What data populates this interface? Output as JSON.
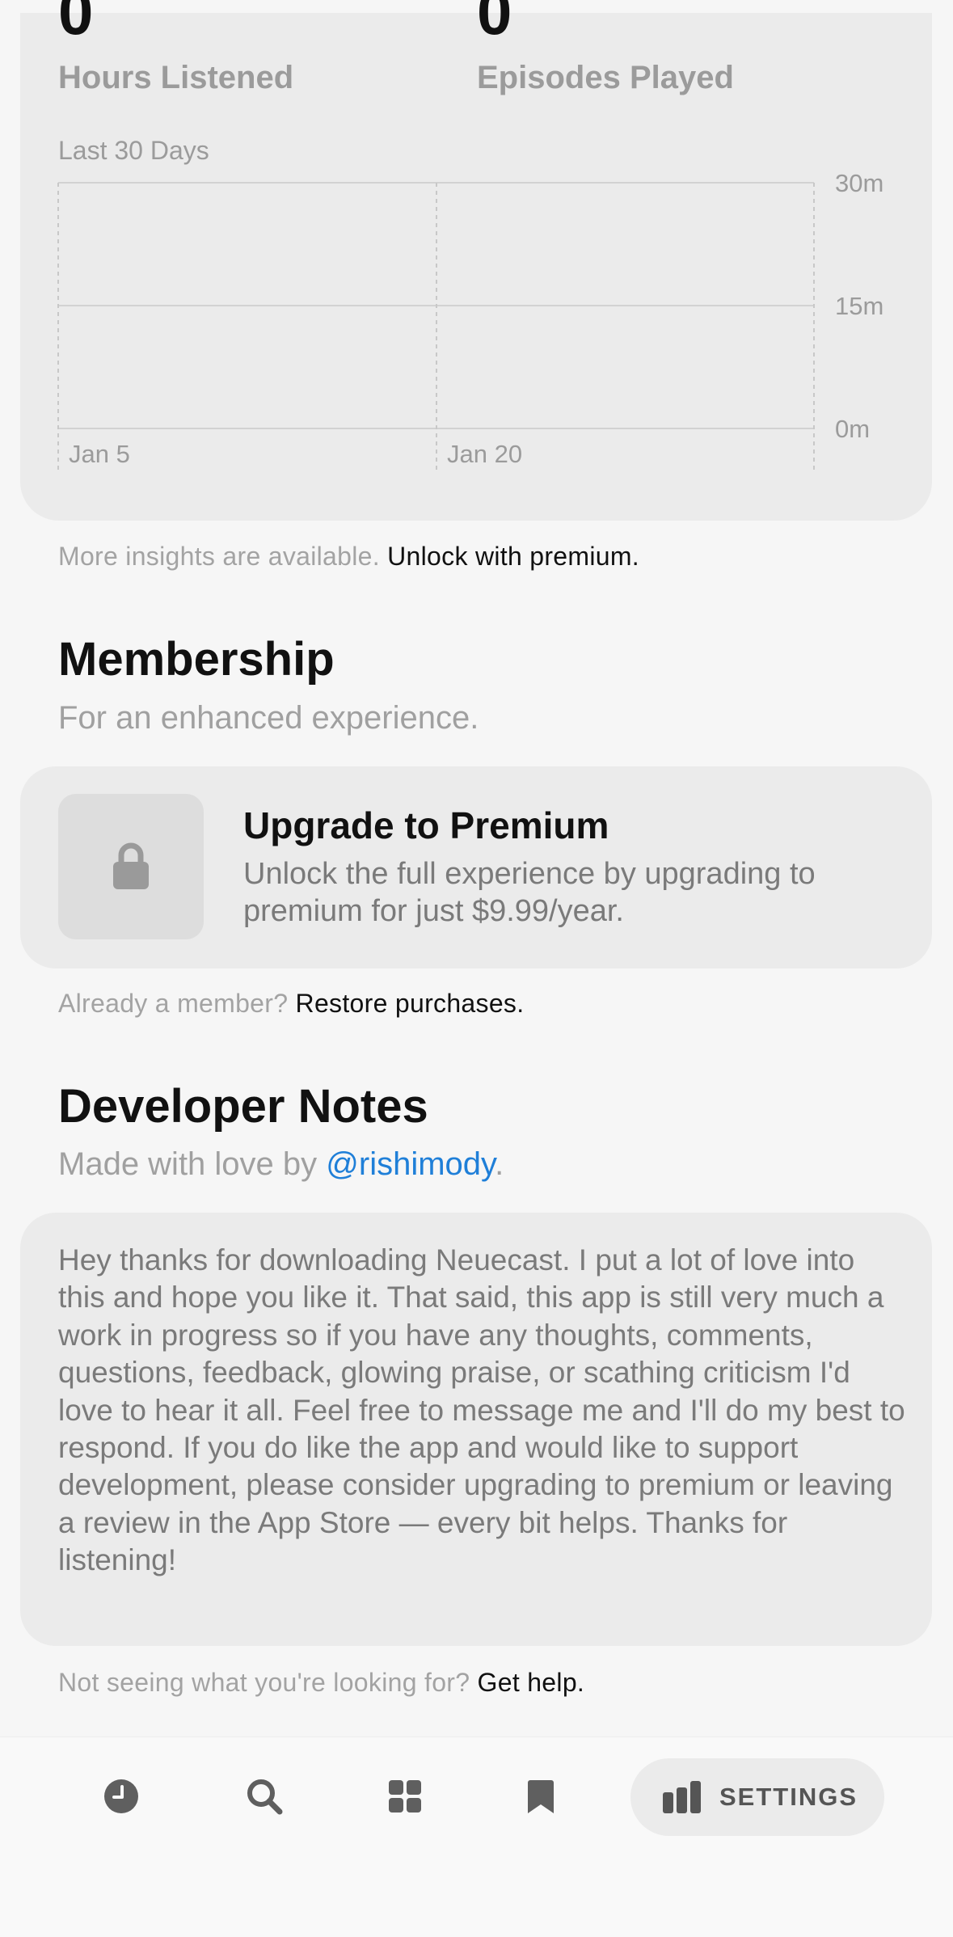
{
  "stats": {
    "hours_value": "0",
    "hours_label": "Hours Listened",
    "episodes_value": "0",
    "episodes_label": "Episodes Played",
    "chart_caption": "Last 30 Days"
  },
  "chart_data": {
    "type": "bar",
    "title": "",
    "categories": [
      "Jan 5",
      "Jan 20"
    ],
    "x_tick_labels": [
      "Jan 5",
      "Jan 20"
    ],
    "y_tick_labels": [
      "30m",
      "15m",
      "0m"
    ],
    "ylim": [
      0,
      30
    ],
    "series": [
      {
        "values": [
          0,
          0
        ]
      }
    ],
    "grid": true
  },
  "insights": {
    "prefix": "More insights are available.",
    "link": "Unlock with premium."
  },
  "membership": {
    "title": "Membership",
    "subtitle": "For an enhanced experience.",
    "card_title": "Upgrade to Premium",
    "card_desc": "Unlock the full experience by upgrading to premium for just $9.99/year.",
    "icon": "lock-icon",
    "restore_prefix": "Already a member?",
    "restore_link": "Restore purchases."
  },
  "developer": {
    "title": "Developer Notes",
    "subtitle_prefix": "Made with love by",
    "handle": "@rishimody",
    "subtitle_suffix": ".",
    "notes": "Hey thanks for downloading Neuecast. I put a lot of love into this and hope you like it. That said, this app is still very much a work in progress so if you have any thoughts, comments, questions, feedback, glowing praise, or scathing criticism I'd love to hear it all. Feel free to message me and I'll do my best to respond. If you do like the app and would like to support development, please consider upgrading to premium or leaving a review in the App Store — every bit helps. Thanks for listening!",
    "help_prefix": "Not seeing what you're looking for?",
    "help_link": "Get help."
  },
  "tabbar": {
    "items": [
      {
        "icon": "clock-icon"
      },
      {
        "icon": "search-icon"
      },
      {
        "icon": "grid-icon"
      },
      {
        "icon": "bookmark-icon"
      }
    ],
    "active_label": "SETTINGS",
    "active_icon": "stats-icon"
  },
  "colors": {
    "accent_link": "#1f7fd8",
    "card_bg": "#ebebeb",
    "page_bg": "#f6f6f6"
  }
}
